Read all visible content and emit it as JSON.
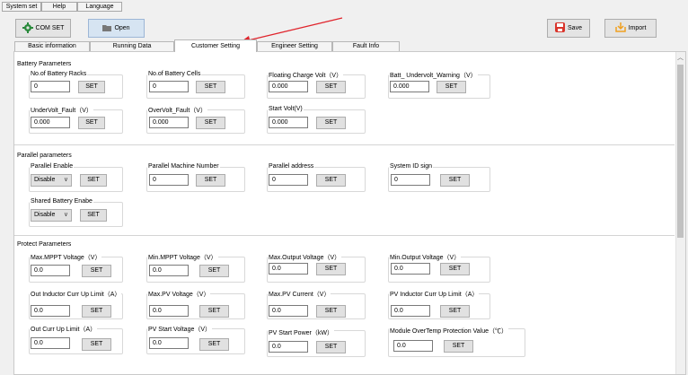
{
  "menu": [
    "System set",
    "Help",
    "Language"
  ],
  "toolbar": {
    "com_set": "COM SET",
    "open": "Open",
    "save": "Save",
    "import": "Import"
  },
  "tabs": [
    "Basic information",
    "Running Data",
    "Customer Setting",
    "Engineer Setting",
    "Fault Info"
  ],
  "active_tab": "Customer Setting",
  "battery": {
    "title": "Battery Parameters",
    "racks": {
      "label": "No.of Battery Racks",
      "value": "0"
    },
    "cells": {
      "label": "No.of Battery Cells",
      "value": "0"
    },
    "floating": {
      "label": "Floating Charge Volt（V）",
      "value": "0.000"
    },
    "undervolt_warning": {
      "label": "Batt_ Undervolt_Warning（V）",
      "value": "0.000"
    },
    "undervolt_fault": {
      "label": "UnderVolt_Fault（V）",
      "value": "0.000"
    },
    "overvolt_fault": {
      "label": "OverVolt_Fault（V）",
      "value": "0.000"
    },
    "start_volt": {
      "label": "Start Volt(V)",
      "value": "0.000"
    }
  },
  "parallel": {
    "title": "Parallel parameters",
    "enable": {
      "label": "Parallel Enable",
      "value": "Disable"
    },
    "machine_number": {
      "label": "Parallel Machine Number",
      "value": "0"
    },
    "address": {
      "label": "Parallel address",
      "value": "0"
    },
    "system_id": {
      "label": "System ID sign",
      "value": "0"
    },
    "shared_battery": {
      "label": "Shared Battery Enabe",
      "value": "Disable"
    }
  },
  "protect": {
    "title": "Protect Parameters",
    "max_mppt": {
      "label": "Max.MPPT Voltage（V）",
      "value": "0.0"
    },
    "min_mppt": {
      "label": "Min.MPPT Voltage（V）",
      "value": "0.0"
    },
    "max_output": {
      "label": "Max.Output Voltage（V）",
      "value": "0.0"
    },
    "min_output": {
      "label": "Min.Output Voltage（V）",
      "value": "0.0"
    },
    "out_inductor": {
      "label": "Out Inductor Curr Up Limit（A）",
      "value": "0.0"
    },
    "max_pv_voltage": {
      "label": "Max.PV Voltage（V）",
      "value": "0.0"
    },
    "max_pv_current": {
      "label": "Max.PV Current（V）",
      "value": "0.0"
    },
    "pv_inductor": {
      "label": "PV Inductor Curr Up Limit（A）",
      "value": "0.0"
    },
    "out_curr": {
      "label": "Out Curr Up Limit（A）",
      "value": "0.0"
    },
    "pv_start_voltage": {
      "label": "PV Start Voltage（V）",
      "value": "0.0"
    },
    "pv_start_power": {
      "label": "PV Start Power（kW）",
      "value": "0.0"
    },
    "module_overtemp": {
      "label": "Module OverTemp Protection Value（℃）",
      "value": "0.0"
    }
  },
  "set_label": "SET",
  "colors": {
    "annotation_arrow": "#e0242c",
    "save_icon": "#d9342b",
    "import_icon": "#f0a020",
    "gear_icon": "#2a8a3c"
  }
}
